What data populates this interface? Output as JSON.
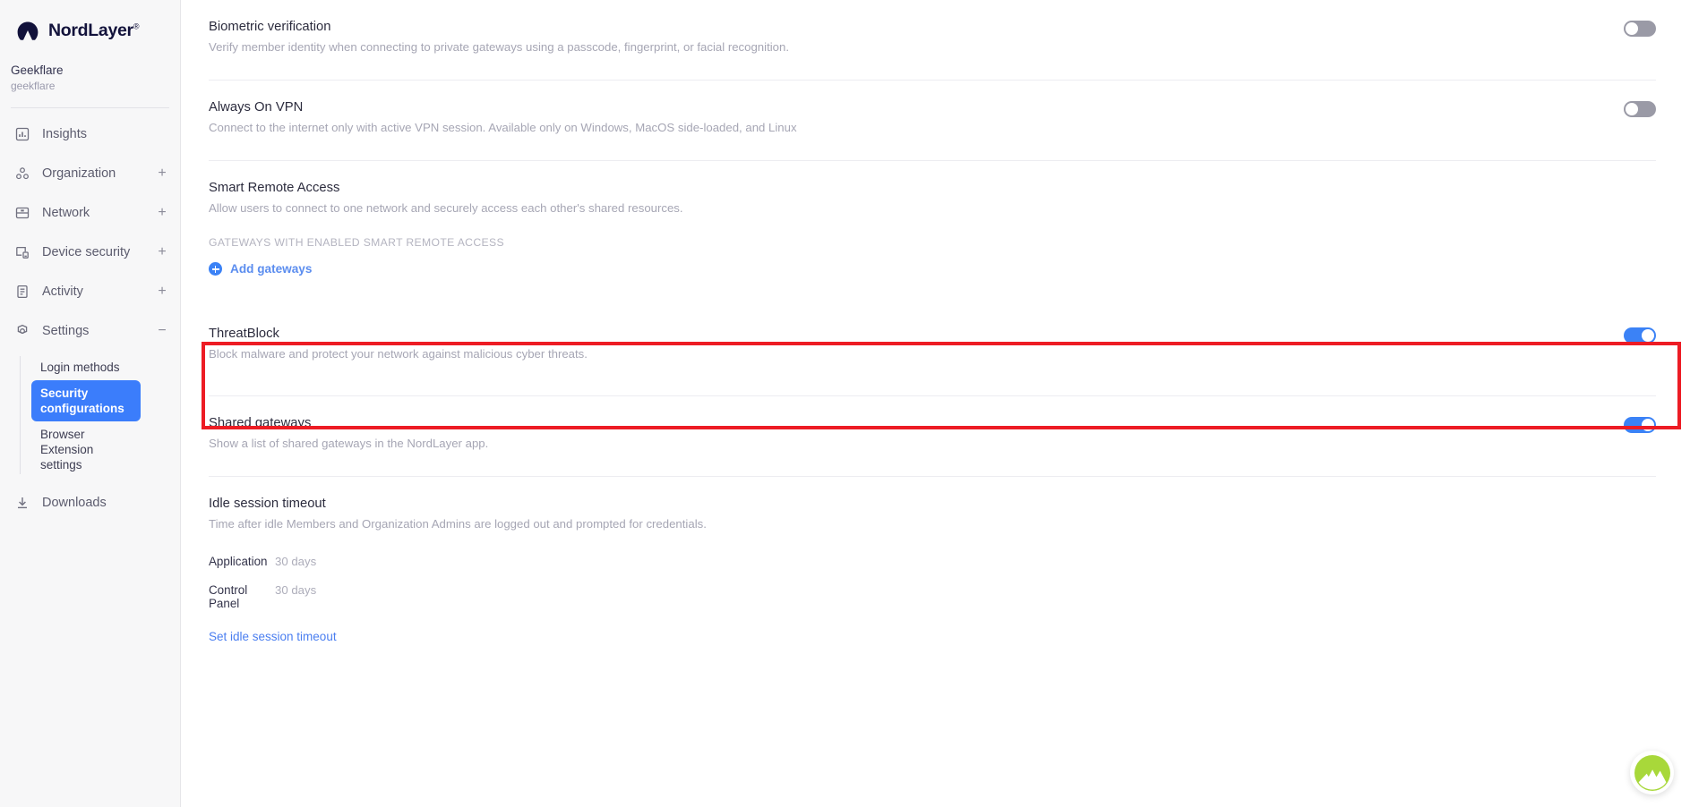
{
  "brand": {
    "name": "NordLayer",
    "registered_mark": "®",
    "logo_icon": "nordlayer-mountain-logo"
  },
  "organization": {
    "name": "Geekflare",
    "slug": "geekflare"
  },
  "sidebar": {
    "items": [
      {
        "label": "Insights",
        "icon": "insights-chart-icon",
        "expander": "",
        "expandable": false
      },
      {
        "label": "Organization",
        "icon": "organization-icon",
        "expander": "+",
        "expandable": true
      },
      {
        "label": "Network",
        "icon": "network-server-icon",
        "expander": "+",
        "expandable": true
      },
      {
        "label": "Device security",
        "icon": "device-security-icon",
        "expander": "+",
        "expandable": true
      },
      {
        "label": "Activity",
        "icon": "activity-document-icon",
        "expander": "+",
        "expandable": true
      },
      {
        "label": "Settings",
        "icon": "settings-gear-icon",
        "expander": "−",
        "expandable": true
      }
    ],
    "settings_subitems": [
      {
        "label": "Login methods",
        "active": false
      },
      {
        "label": "Security configurations",
        "active": true
      },
      {
        "label": "Browser Extension settings",
        "active": false
      }
    ],
    "downloads": {
      "label": "Downloads",
      "icon": "download-icon"
    }
  },
  "settings": {
    "biometric": {
      "title": "Biometric verification",
      "description": "Verify member identity when connecting to private gateways using a passcode, fingerprint, or facial recognition.",
      "toggle_state": "off"
    },
    "always_on_vpn": {
      "title": "Always On VPN",
      "description": "Connect to the internet only with active VPN session. Available only on Windows, MacOS side-loaded, and Linux",
      "toggle_state": "off"
    },
    "smart_remote_access": {
      "title": "Smart Remote Access",
      "description": "Allow users to connect to one network and securely access each other's shared resources.",
      "subheading": "GATEWAYS WITH ENABLED SMART REMOTE ACCESS",
      "add_link": "Add gateways"
    },
    "threatblock": {
      "title": "ThreatBlock",
      "description": "Block malware and protect your network against malicious cyber threats.",
      "toggle_state": "on",
      "highlighted": true,
      "highlight_color": "#ed1c24"
    },
    "shared_gateways": {
      "title": "Shared gateways",
      "description": "Show a list of shared gateways in the NordLayer app.",
      "toggle_state": "on"
    },
    "idle_session_timeout": {
      "title": "Idle session timeout",
      "description": "Time after idle Members and Organization Admins are logged out and prompted for credentials.",
      "rows": [
        {
          "key": "Application",
          "value": "30 days"
        },
        {
          "key": "Control Panel",
          "value": "30 days"
        }
      ],
      "action_link": "Set idle session timeout"
    }
  },
  "fab": {
    "icon": "nordlayer-mountain-badge",
    "color": "#a8d83a"
  },
  "colors": {
    "accent_blue": "#3b82f6",
    "link_blue": "#4a7ef0",
    "highlight_red": "#ed1c24",
    "sidebar_bg": "#f7f7f8",
    "toggle_off": "#9a9aa6"
  }
}
